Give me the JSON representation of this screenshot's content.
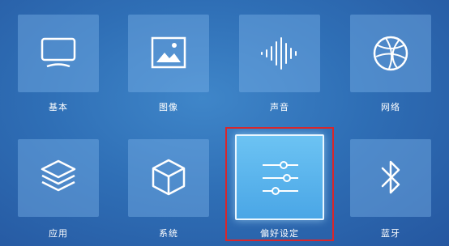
{
  "tiles": [
    {
      "label": "基本",
      "icon": "monitor-icon"
    },
    {
      "label": "图像",
      "icon": "image-icon"
    },
    {
      "label": "声音",
      "icon": "sound-wave-icon"
    },
    {
      "label": "网络",
      "icon": "globe-icon"
    },
    {
      "label": "应用",
      "icon": "layers-icon"
    },
    {
      "label": "系统",
      "icon": "cube-icon"
    },
    {
      "label": "偏好设定",
      "icon": "sliders-icon",
      "selected": true
    },
    {
      "label": "蓝牙",
      "icon": "bluetooth-icon"
    }
  ],
  "colors": {
    "background": "#2f6fb6",
    "tile": "#78afe6",
    "selected_tile": "#5ab4ec",
    "highlight": "#d9262b"
  }
}
